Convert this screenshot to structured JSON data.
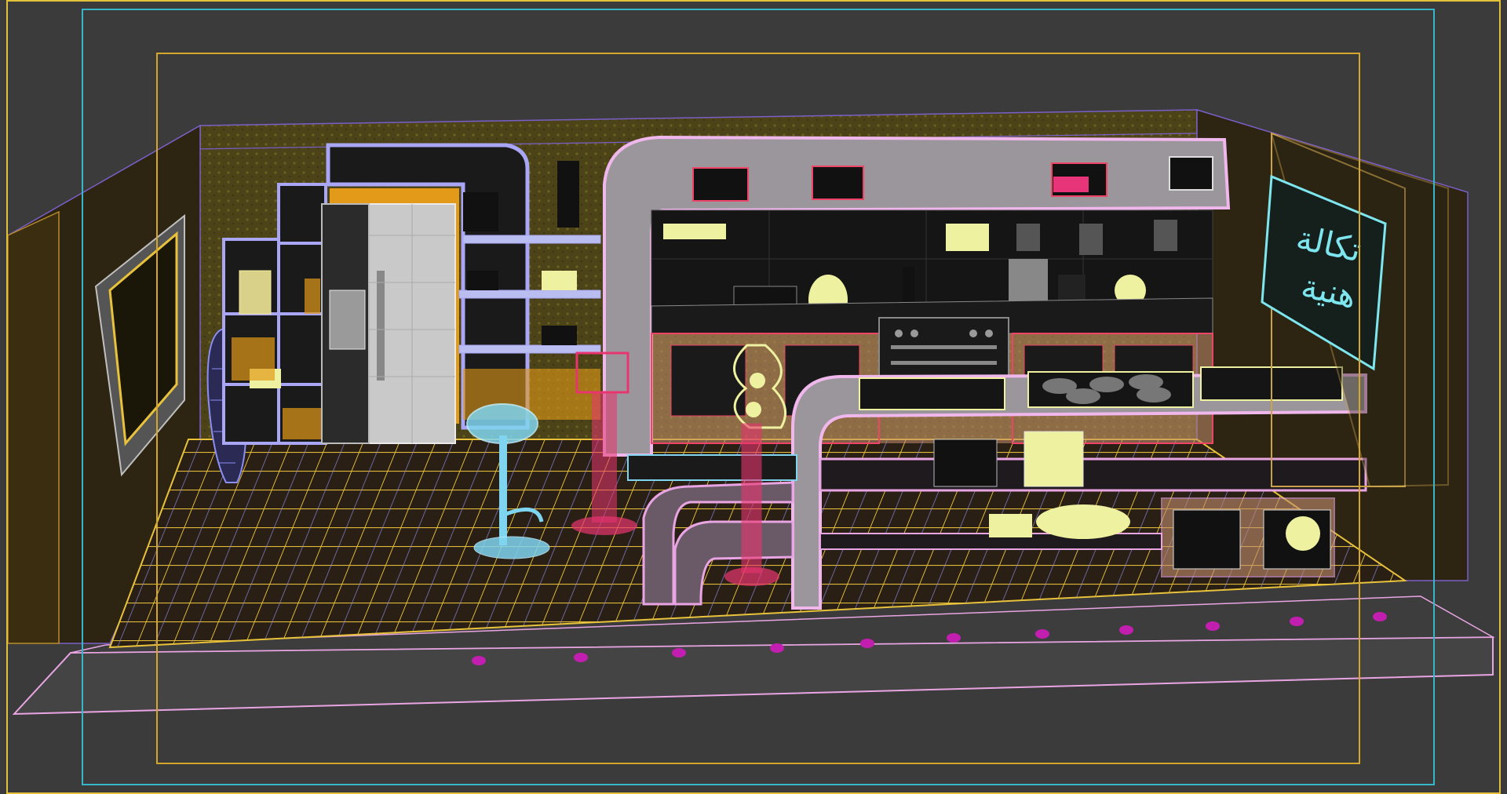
{
  "viewport": {
    "background": "#3b3b3b",
    "safe_frame_outer_color": "#e2c03a",
    "safe_frame_mid_color": "#36b6c8",
    "safe_frame_inner_color": "#d4a72a"
  },
  "scene": {
    "sign": {
      "line1": "تكالة",
      "line2": "هنية"
    },
    "colors": {
      "floor": "#2a1f15",
      "floor_grid": "#e8c23a",
      "floor_grid_alt": "#8a8ee8",
      "wall": "#4c4418",
      "wall_side": "#2d2412",
      "counter_trim": "#e6a2e0",
      "counter_red": "#ee4466",
      "shelf_blue": "#a9a6f5",
      "fridge": "#c9c9c9",
      "orange_fill": "#e39a18",
      "stool_cyan": "#7fd5f0",
      "pink_pillar": "#e8356f",
      "yellow_object": "#eef2a0",
      "base_led": "#c21fb0",
      "sign_frame": "#7ee6ef"
    }
  }
}
